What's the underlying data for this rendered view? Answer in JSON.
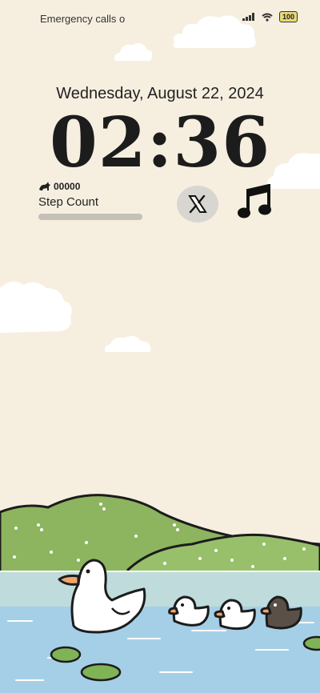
{
  "status_bar": {
    "carrier_text": "Emergency calls o",
    "icons": [
      "signal-icon",
      "wifi-icon",
      "battery-icon"
    ],
    "battery_label": "100"
  },
  "lockscreen": {
    "date": "Wednesday, August  22, 2024",
    "time": "02:36"
  },
  "widgets": {
    "steps": {
      "icon": "cat-icon",
      "count": "00000",
      "label": "Step Count",
      "progress": 0.0
    },
    "x_icon": "x-logo-icon",
    "music_icon": "music-note-icon"
  },
  "colors": {
    "background": "#f6efe0",
    "hills": "#8db45f",
    "water": "#a5cfe6",
    "cloud": "#ffffff"
  }
}
